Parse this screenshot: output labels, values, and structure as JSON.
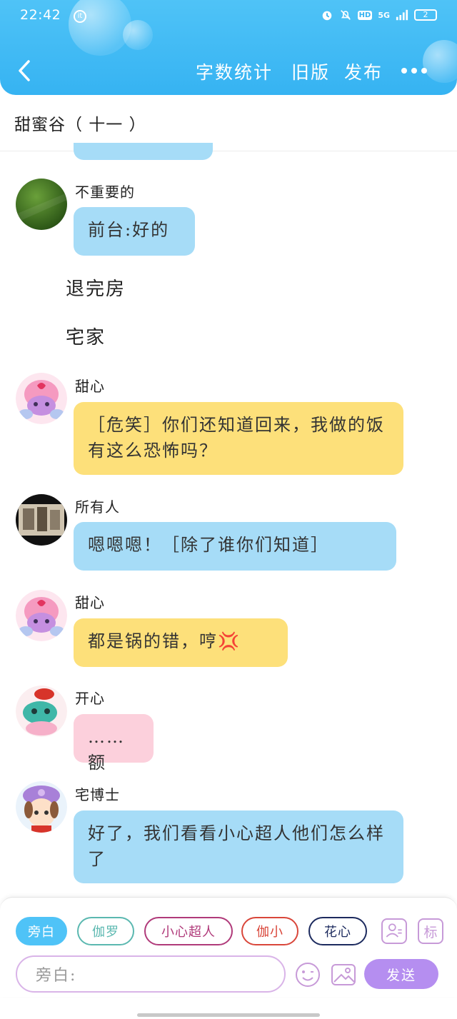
{
  "status_bar": {
    "time": "22:42",
    "app_badge": "it",
    "network": "5G",
    "hd": "HD",
    "battery": "2"
  },
  "header": {
    "links": [
      "字数统计",
      "旧版",
      "发布"
    ],
    "more": "•••"
  },
  "document": {
    "title": "甜蜜谷（ 十一 ）"
  },
  "messages": [
    {
      "type": "chat",
      "speaker": "不重要的",
      "text": "前台:好的",
      "color": "blue"
    },
    {
      "type": "narration",
      "text": "退完房"
    },
    {
      "type": "narration",
      "text": "宅家"
    },
    {
      "type": "chat",
      "speaker": "甜心",
      "text": "［危笑］你们还知道回来，我做的饭有这么恐怖吗？",
      "color": "yellow"
    },
    {
      "type": "chat",
      "speaker": "所有人",
      "text": "嗯嗯嗯！［除了谁你们知道］",
      "color": "blue"
    },
    {
      "type": "chat",
      "speaker": "甜心",
      "text": "都是锅的错，哼💢",
      "color": "yellow"
    },
    {
      "type": "chat",
      "speaker": "开心",
      "text": "……额",
      "color": "pink"
    },
    {
      "type": "chat",
      "speaker": "宅博士",
      "text": "好了，我们看看小心超人他们怎么样了",
      "color": "blue"
    }
  ],
  "composer": {
    "roles": [
      {
        "label": "旁白",
        "border": "#4fc3f7",
        "text_color": "#ffffff",
        "fill": "#4fc3f7"
      },
      {
        "label": "伽罗",
        "border": "#5bb8b0",
        "text_color": "#5bb8b0",
        "fill": "#ffffff"
      },
      {
        "label": "小心超人",
        "border": "#b03a7a",
        "text_color": "#b03a7a",
        "fill": "#ffffff"
      },
      {
        "label": "伽小",
        "border": "#d9463a",
        "text_color": "#d9463a",
        "fill": "#ffffff"
      },
      {
        "label": "花心",
        "border": "#1c2a5e",
        "text_color": "#1c2a5e",
        "fill": "#ffffff"
      }
    ],
    "tool_label": "标",
    "input_placeholder": "旁白:",
    "send_label": "发送"
  },
  "colors": {
    "header": "#36b3f2",
    "bubble_blue": "#a6dcf7",
    "bubble_yellow": "#fde07a",
    "bubble_pink": "#fcd0dc",
    "send": "#b58ef0"
  }
}
